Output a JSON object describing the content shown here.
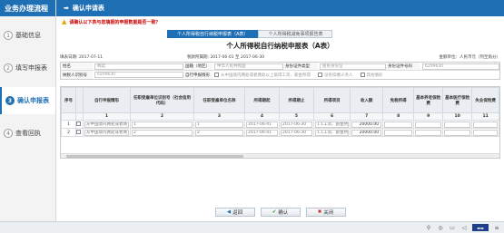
{
  "sidebar": {
    "title": "业务办理流程",
    "items": [
      {
        "num": "1",
        "label": "基础信息",
        "active": false
      },
      {
        "num": "2",
        "label": "填写申报表",
        "active": false
      },
      {
        "num": "3",
        "label": "确认申报表",
        "active": true
      },
      {
        "num": "4",
        "label": "查看回执",
        "active": false
      }
    ]
  },
  "header": {
    "title": "确认申请表"
  },
  "warning": "请确认以下表与您填报的申报数据是否一致？",
  "tabs": [
    {
      "label": "个人所得税自行纳税申报表（A表）",
      "active": true
    },
    {
      "label": "个人所得税减免事项报告表",
      "active": false
    }
  ],
  "form": {
    "title": "个人所得税自行纳税申报表（A表）",
    "fill_date": "填表日期: 2017-07-11",
    "tax_period": "税款所属期: 2017-06-01 至 2017-06-30",
    "currency": "金额单位：人民币元（列至角分）"
  },
  "info": {
    "name_label": "姓名",
    "name_value": "韩奕",
    "nation_label": "国籍（地区）",
    "nation_value": "中华人民共和国",
    "id_type_label": "身份证件类型",
    "id_type_value": "居民身份证",
    "id_no_label": "身份证件号码",
    "id_no_value": "6209630",
    "type_label": "自行申报情形",
    "person_label": "纳税人识别号",
    "person_value": "6209630",
    "opt1": "从中国境内两处或者两处以上取得工资、薪金所得",
    "opt2": "没有扣缴义务人",
    "opt3": "其他情形"
  },
  "table": {
    "headers": [
      "序号",
      "",
      "自行申报情形",
      "任职受雇单位识别号（社会信用代码）",
      "任职受雇单位名称",
      "所得期起",
      "所得期止",
      "所得项目",
      "收入额",
      "免税所得",
      "基本养老保险费",
      "基本医疗保险费",
      "失业保险费"
    ],
    "numbers": [
      "",
      "",
      "1",
      "2",
      "3",
      "4",
      "5",
      "6",
      "7",
      "8",
      "9",
      "10",
      "11"
    ],
    "rows": [
      {
        "seq": "1",
        "situation": "从中国境内两处或者两",
        "code": "1",
        "unit": "1",
        "from": "2017-06-01",
        "to": "2017-06-30",
        "item": "1.1工资、薪金所",
        "income": "20000.00",
        "tax_free": "",
        "pension": "",
        "medical": "",
        "unemploy": ""
      },
      {
        "seq": "2",
        "situation": "从中国境内两处或者两",
        "code": "2",
        "unit": "2",
        "from": "2017-06-01",
        "to": "2017-06-30",
        "item": "1.1工资、薪金所",
        "income": "20000.00",
        "tax_free": "",
        "pension": "",
        "medical": "",
        "unemploy": ""
      }
    ]
  },
  "buttons": {
    "back": "返回",
    "confirm": "确认",
    "close": "关闭"
  },
  "colors": {
    "brand": "#1f6fb4",
    "warning": "#cc0000"
  }
}
